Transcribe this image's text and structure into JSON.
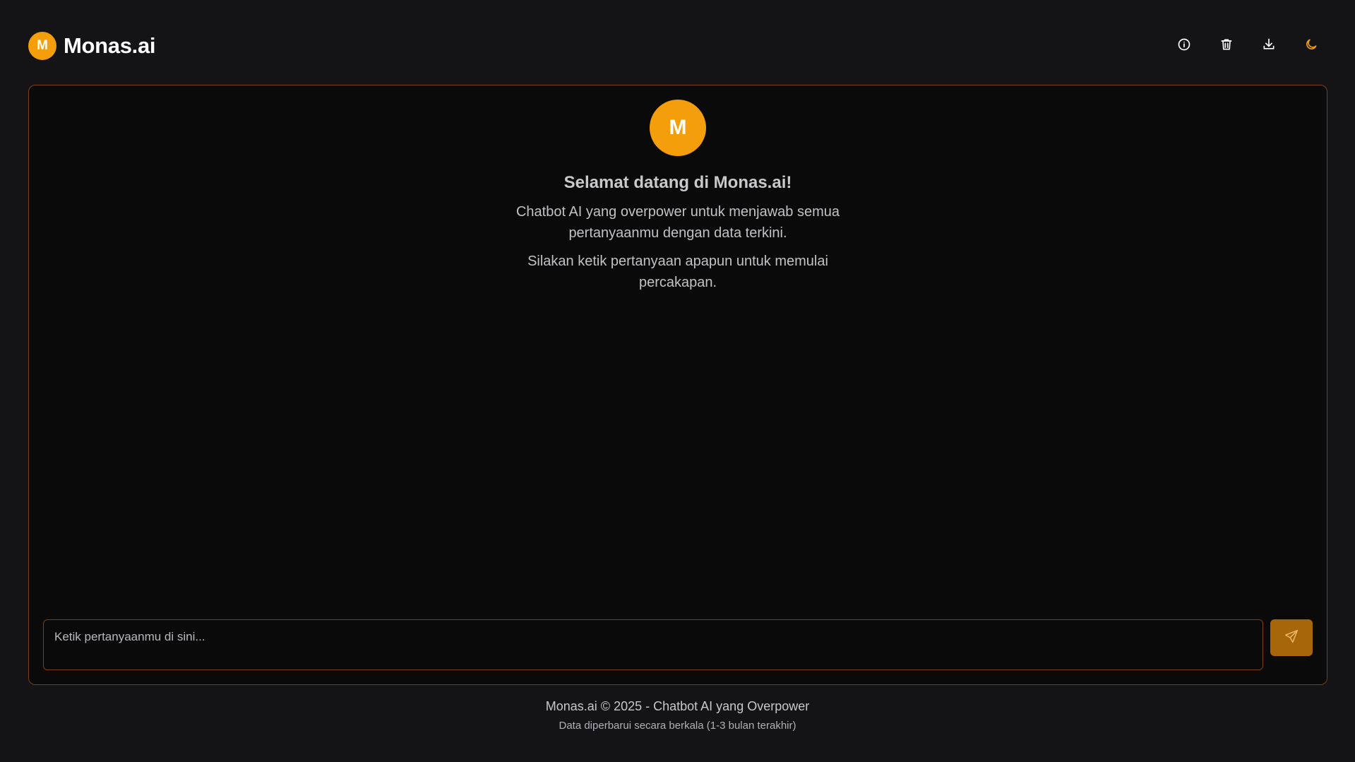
{
  "header": {
    "logo_letter": "M",
    "title": "Monas.ai",
    "actions": [
      {
        "name": "info-icon",
        "color": "#ffffff"
      },
      {
        "name": "trash-icon",
        "color": "#ffffff"
      },
      {
        "name": "download-icon",
        "color": "#ffffff"
      },
      {
        "name": "moon-icon",
        "color": "#f59e0b"
      }
    ]
  },
  "welcome": {
    "avatar_letter": "M",
    "title": "Selamat datang di Monas.ai!",
    "line1": "Chatbot AI yang overpower untuk menjawab semua pertanyaanmu dengan data terkini.",
    "line2": "Silakan ketik pertanyaan apapun untuk memulai percakapan."
  },
  "input": {
    "value": "",
    "placeholder": "Ketik pertanyaanmu di sini..."
  },
  "send_button": {
    "icon": "send-icon"
  },
  "footer": {
    "main": "Monas.ai © 2025 - Chatbot AI yang Overpower",
    "sub": "Data diperbarui secara berkala (1-3 bulan terakhir)"
  },
  "colors": {
    "accent": "#f59e0b",
    "border": "#7c3f12",
    "background": "#141416",
    "panel": "#0a0a0b",
    "send_button": "#a8660b"
  }
}
